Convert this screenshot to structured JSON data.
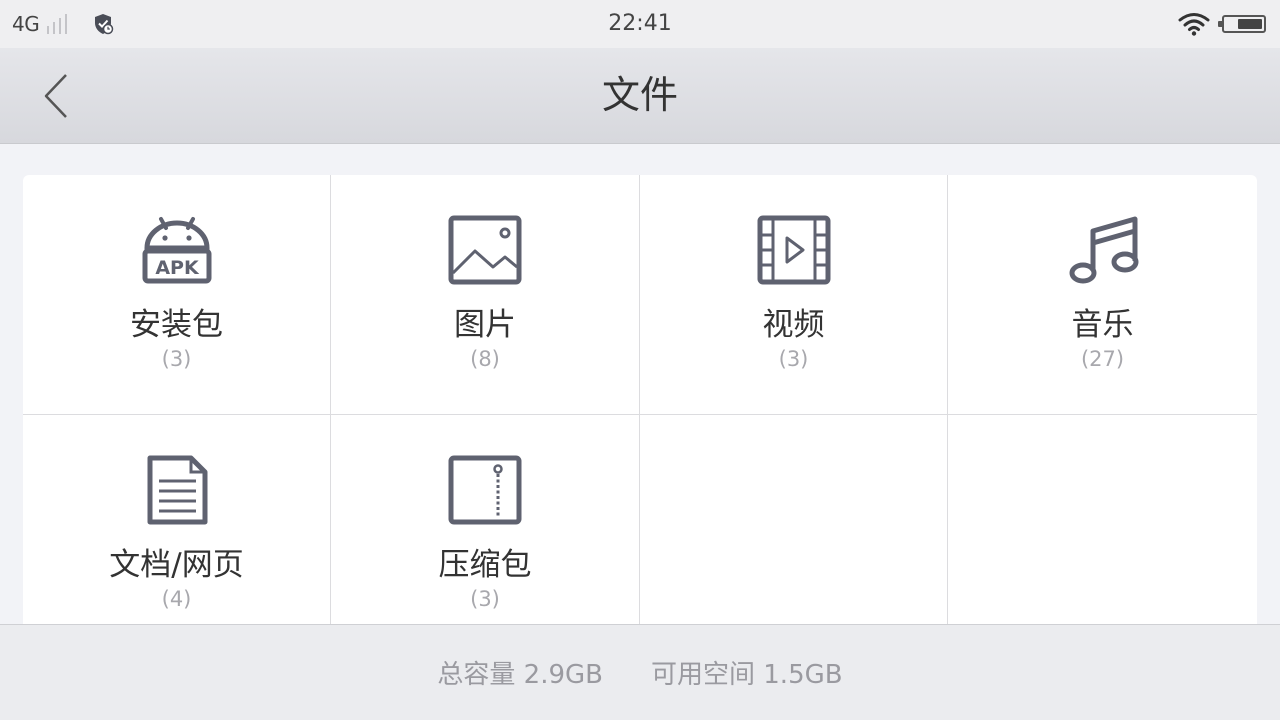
{
  "status_bar": {
    "carrier": "4G",
    "time": "22:41",
    "icons": [
      "signal-bars-icon",
      "shield-icon",
      "wifi-icon",
      "battery-icon"
    ]
  },
  "header": {
    "title": "文件",
    "back_icon": "chevron-left-icon"
  },
  "categories": [
    {
      "label": "安装包",
      "count": "(3)",
      "icon": "android-apk-icon"
    },
    {
      "label": "图片",
      "count": "(8)",
      "icon": "image-icon"
    },
    {
      "label": "视频",
      "count": "(3)",
      "icon": "video-icon"
    },
    {
      "label": "音乐",
      "count": "(27)",
      "icon": "music-note-icon"
    },
    {
      "label": "文档/网页",
      "count": "(4)",
      "icon": "document-icon"
    },
    {
      "label": "压缩包",
      "count": "(3)",
      "icon": "zip-archive-icon"
    }
  ],
  "footer": {
    "total_storage": "总容量 2.9GB",
    "available_space": "可用空间 1.5GB"
  },
  "colors": {
    "icon": "#5f6270",
    "count_text": "#a8a8ad",
    "footer_text": "#9a9aa0"
  }
}
